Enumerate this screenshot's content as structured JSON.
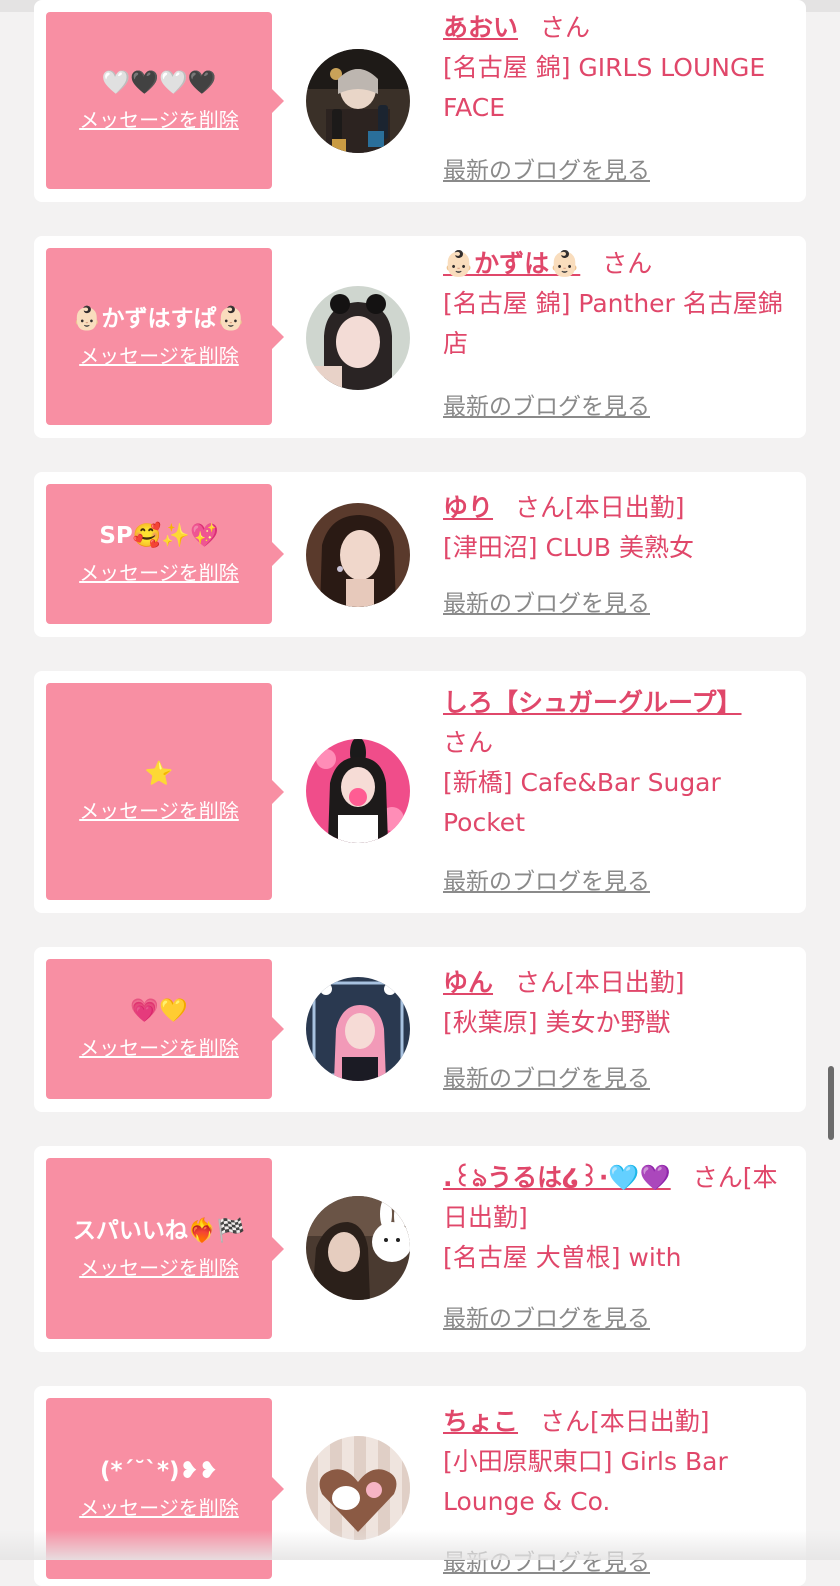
{
  "colors": {
    "page_bg": "#f3f2f2",
    "bubble_bg": "#f88fa3",
    "accent_text": "#e0476a",
    "blog_link": "#8a8a8a"
  },
  "messages": [
    {
      "message": "🤍🖤🤍🖤",
      "delete_label": "メッセージを削除",
      "name": "あおい",
      "honorific": "さん",
      "status": "",
      "shop": "[名古屋 錦] GIRLS LOUNGE FACE",
      "blog_label": "最新のブログを見る"
    },
    {
      "message": "👶🏻かずはすぱ👶🏻",
      "delete_label": "メッセージを削除",
      "name": "👶🏻かずは👶🏻",
      "honorific": "さん",
      "status": "",
      "shop": "[名古屋 錦] Panther 名古屋錦店",
      "blog_label": "最新のブログを見る"
    },
    {
      "message": "SP🥰✨💖",
      "delete_label": "メッセージを削除",
      "name": "ゆり",
      "honorific": "さん",
      "status": "[本日出勤]",
      "shop": "[津田沼] CLUB 美熟女",
      "blog_label": "最新のブログを見る"
    },
    {
      "message": "⭐️",
      "delete_label": "メッセージを削除",
      "name": "しろ【シュガーグループ】",
      "honorific": "さん",
      "status": "",
      "shop": "[新橋] Cafe&Bar Sugar Pocket",
      "blog_label": "最新のブログを見る"
    },
    {
      "message": "💗💛",
      "delete_label": "メッセージを削除",
      "name": "ゆん",
      "honorific": "さん",
      "status": "[本日出勤]",
      "shop": "[秋葉原] 美女か野獣",
      "blog_label": "最新のブログを見る"
    },
    {
      "message": "スパいいね❤️‍🔥🏁",
      "delete_label": "メッセージを削除",
      "name": ".꒰ঌうるは໒꒱·🩵💜",
      "honorific": "さん",
      "status": "[本日出勤]",
      "shop": "[名古屋 大曽根] with",
      "blog_label": "最新のブログを見る"
    },
    {
      "message": "(*ˊ˘ˋ*)❥❥",
      "delete_label": "メッセージを削除",
      "name": "ちょこ",
      "honorific": "さん",
      "status": "[本日出勤]",
      "shop": "[小田原駅東口] Girls Bar Lounge & Co.",
      "blog_label": "最新のブログを見る"
    }
  ]
}
